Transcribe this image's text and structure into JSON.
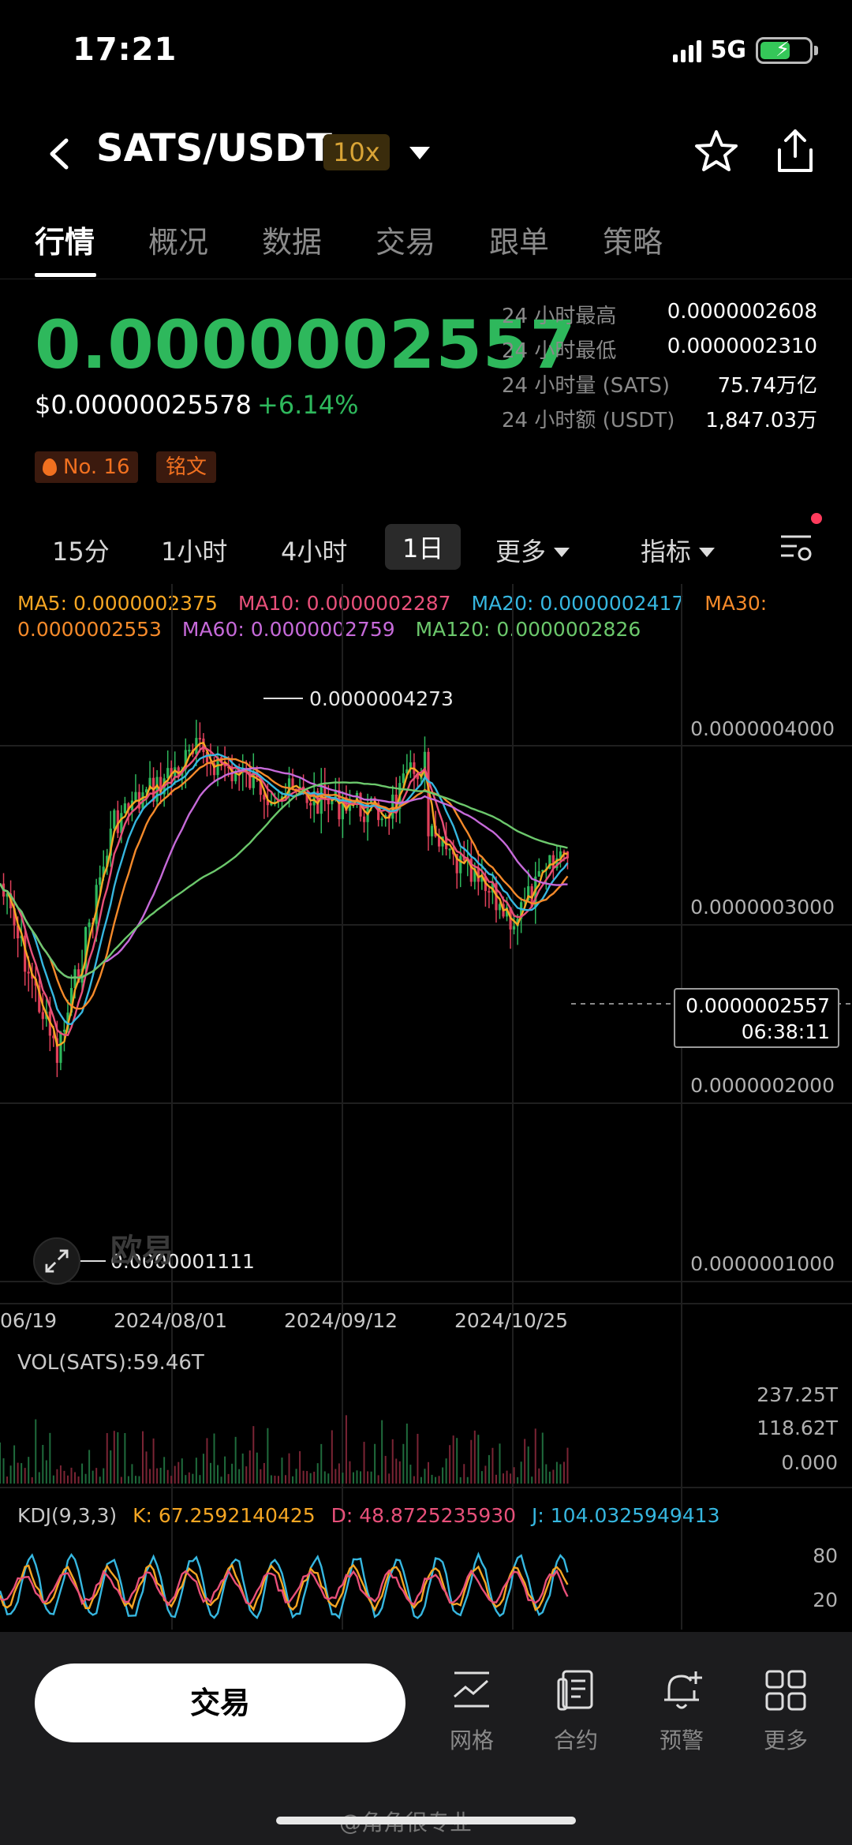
{
  "status": {
    "time": "17:21",
    "network": "5G"
  },
  "header": {
    "title": "SATS/USDT",
    "leverage": "10x"
  },
  "tabs": [
    "行情",
    "概况",
    "数据",
    "交易",
    "跟单",
    "策略"
  ],
  "price": {
    "last": "0.0000002557",
    "usd": "$0.00000025578",
    "change": "+6.14%",
    "rank_tag": "No. 16",
    "category_tag": "铭文"
  },
  "stats": [
    {
      "label": "24 小时最高",
      "value": "0.0000002608"
    },
    {
      "label": "24 小时最低",
      "value": "0.0000002310"
    },
    {
      "label": "24 小时量 (SATS)",
      "value": "75.74万亿"
    },
    {
      "label": "24 小时额 (USDT)",
      "value": "1,847.03万"
    }
  ],
  "timeframes": {
    "t1": "15分",
    "t2": "1小时",
    "t3": "4小时",
    "t4": "1日",
    "more": "更多",
    "indicators": "指标"
  },
  "ma": {
    "ma5": "MA5: 0.0000002375",
    "ma10": "MA10: 0.0000002287",
    "ma20": "MA20: 0.0000002417",
    "ma30": "MA30: 0.0000002553",
    "ma60": "MA60: 0.0000002759",
    "ma120": "MA120: 0.0000002826"
  },
  "chart_data": {
    "type": "line",
    "price_axis": [
      "0.0000004000",
      "0.0000003000",
      "0.0000002000",
      "0.0000001000"
    ],
    "dates": [
      "06/19",
      "2024/08/01",
      "2024/09/12",
      "2024/10/25"
    ],
    "high_marker": "0.0000004273",
    "low_marker": "0.0000001111",
    "current_price": "0.0000002557",
    "countdown": "06:38:11",
    "watermark": "欧易",
    "series": [
      {
        "name": "MA5",
        "color": "#f5a623"
      },
      {
        "name": "MA10",
        "color": "#e8507a"
      },
      {
        "name": "MA20",
        "color": "#36b7e0"
      },
      {
        "name": "MA30",
        "color": "#f58a2a"
      },
      {
        "name": "MA60",
        "color": "#c66ad9"
      },
      {
        "name": "MA120",
        "color": "#6cc86c"
      }
    ]
  },
  "volume": {
    "label": "VOL(SATS):59.46T",
    "axis": [
      "237.25T",
      "118.62T",
      "0.000"
    ]
  },
  "kdj": {
    "name": "KDJ(9,3,3)",
    "k": "K: 67.2592140425",
    "d": "D: 48.8725235930",
    "j": "J: 104.0325949413",
    "axis": [
      "80",
      "20"
    ]
  },
  "bottom": {
    "trade": "交易",
    "nav": [
      "网格",
      "合约",
      "预警",
      "更多"
    ],
    "watermark": "@角角很专业"
  },
  "colors": {
    "green": "#2eb85c",
    "red": "#e0405a",
    "accent_orange": "#f07020"
  }
}
